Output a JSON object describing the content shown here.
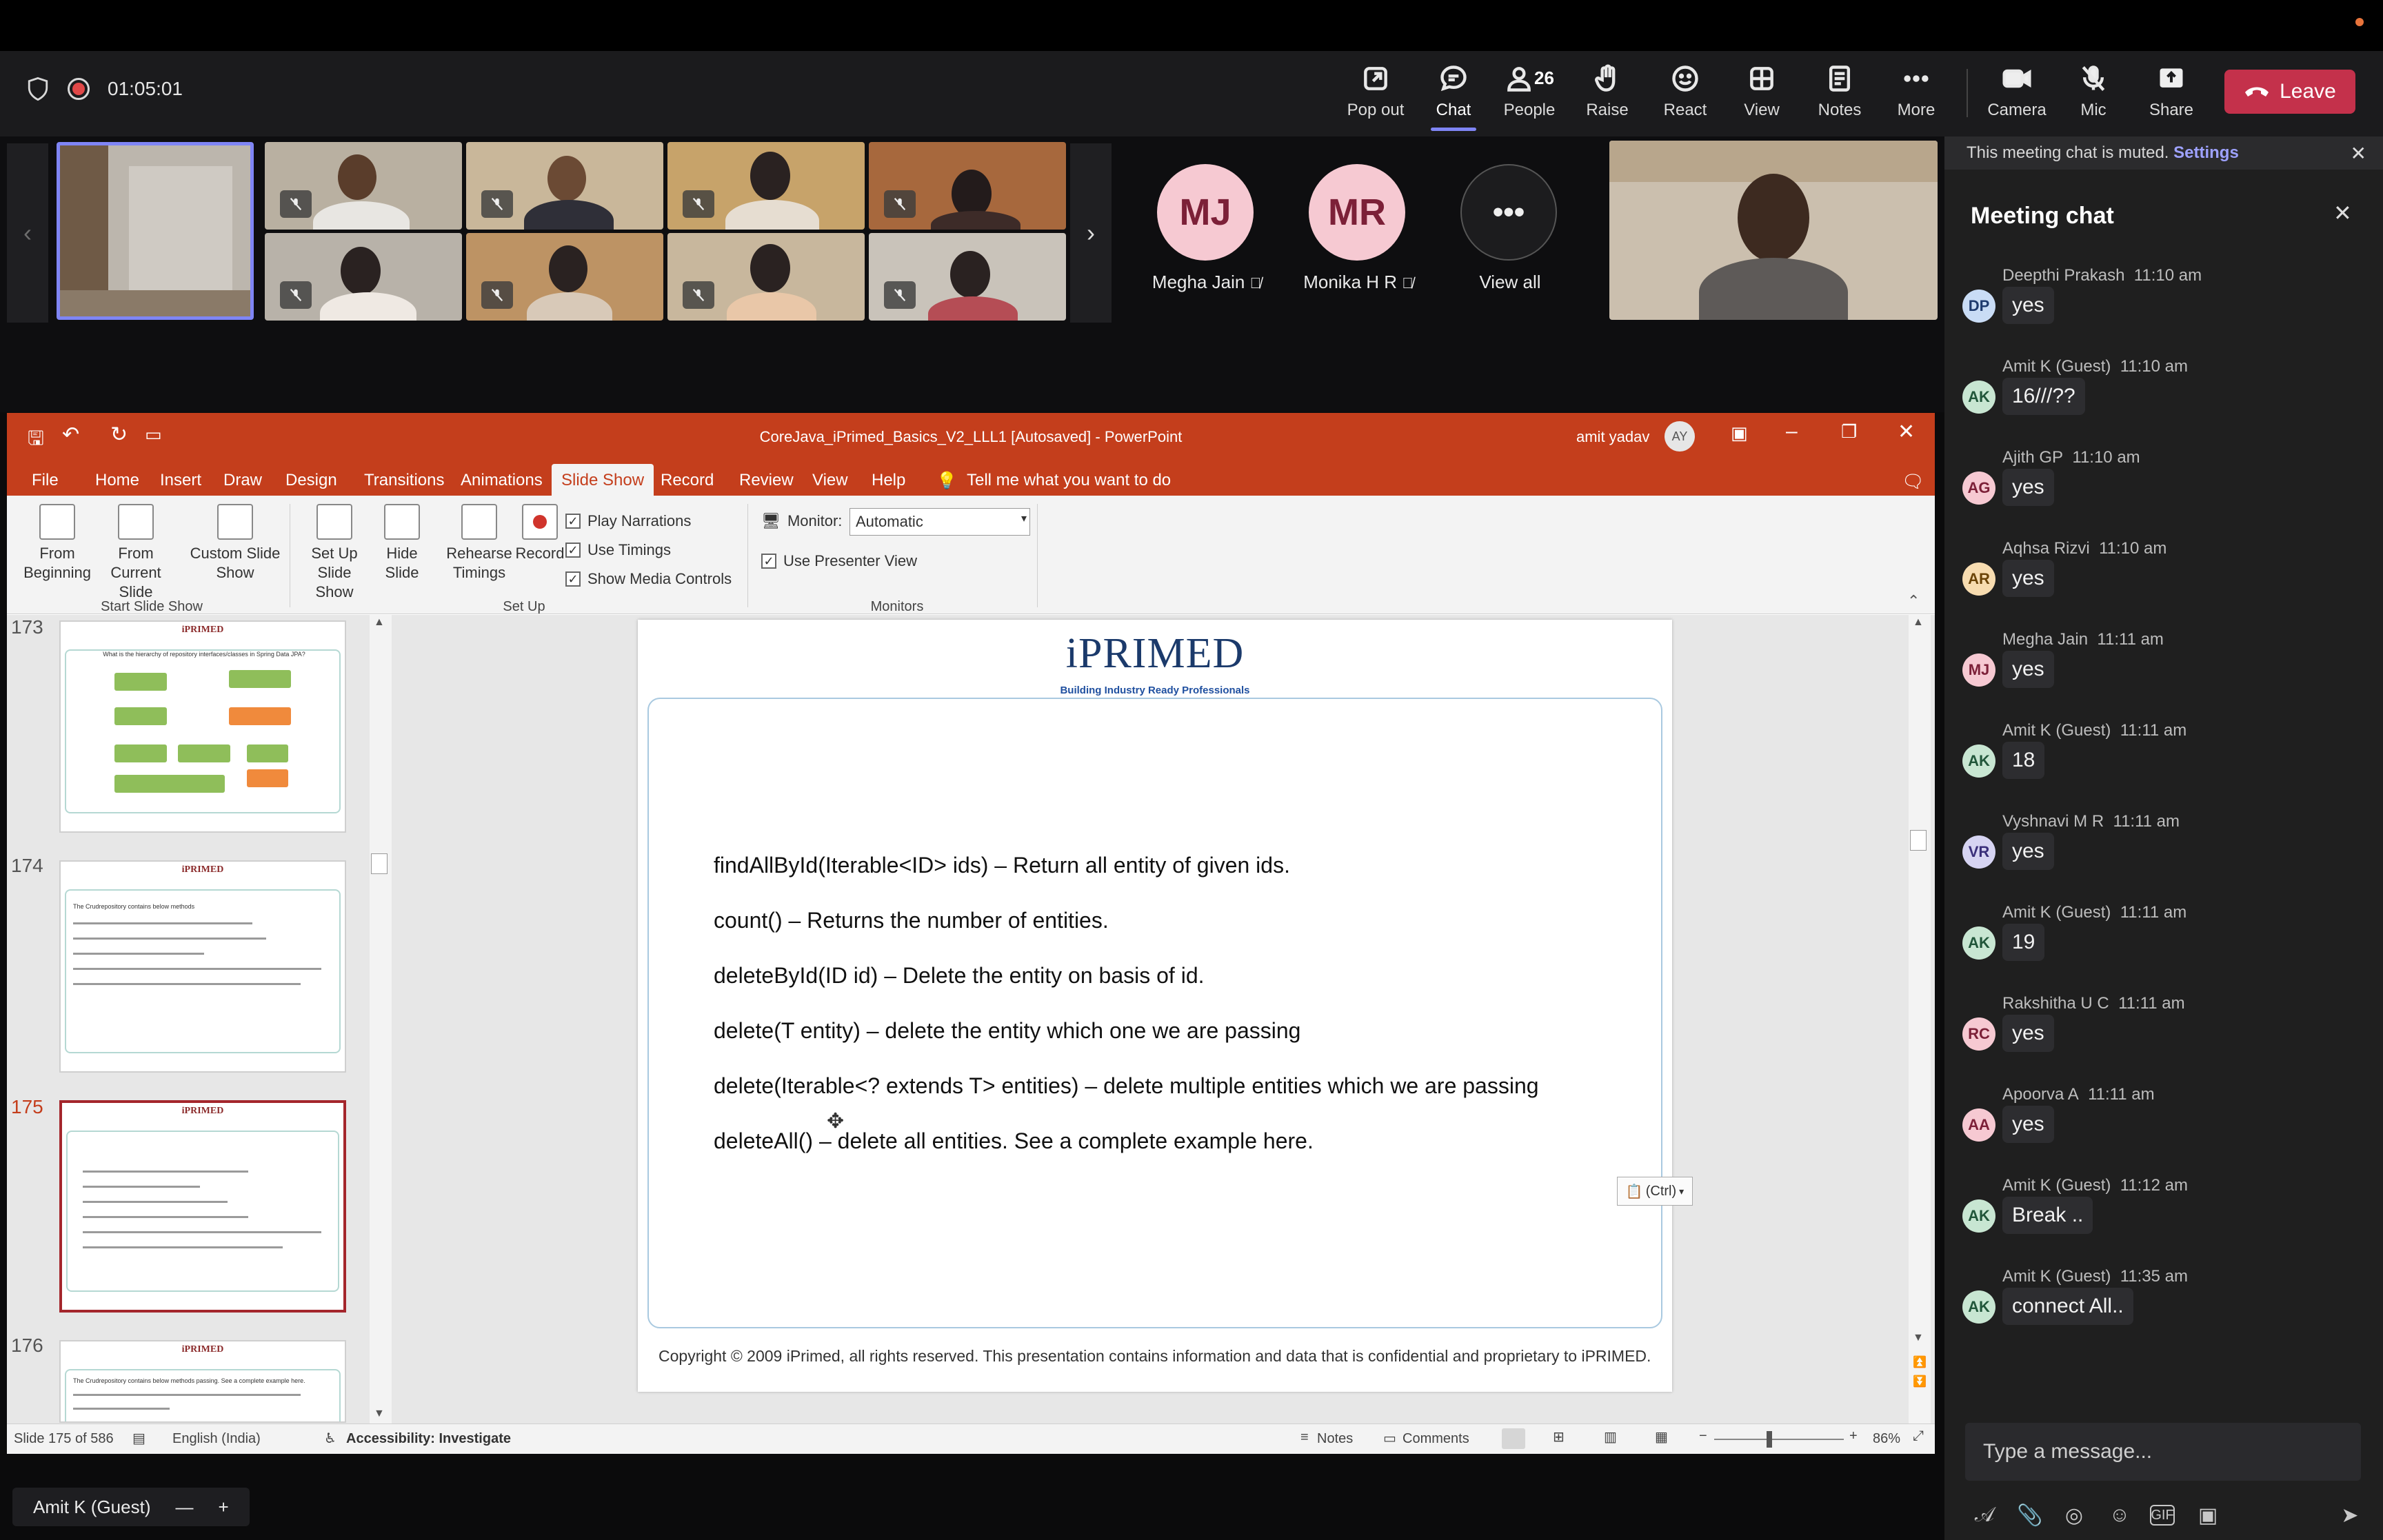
{
  "meeting": {
    "timer": "01:05:01",
    "toolbar": {
      "popout": "Pop out",
      "chat": "Chat",
      "people": "People",
      "people_count": "26",
      "raise": "Raise",
      "react": "React",
      "view": "View",
      "notes": "Notes",
      "more": "More",
      "camera": "Camera",
      "mic": "Mic",
      "share": "Share",
      "leave": "Leave"
    },
    "participants": [
      {
        "initials": "MJ",
        "name": "Megha Jain"
      },
      {
        "initials": "MR",
        "name": "Monika H R"
      }
    ],
    "view_all": "View all",
    "presenter_tag": "Amit K (Guest)",
    "zoom_out": "—",
    "zoom_in": "+"
  },
  "powerpoint": {
    "window_title": "CoreJava_iPrimed_Basics_V2_LLL1 [Autosaved]  -  PowerPoint",
    "user_name": "amit yadav",
    "user_initials": "AY",
    "tabs": [
      "File",
      "Home",
      "Insert",
      "Draw",
      "Design",
      "Transitions",
      "Animations",
      "Slide Show",
      "Record",
      "Review",
      "View",
      "Help"
    ],
    "active_tab": "Slide Show",
    "tell_me": "Tell me what you want to do",
    "ribbon": {
      "from_beginning": "From Beginning",
      "from_current": "From Current Slide",
      "custom_show": "Custom Slide Show",
      "group_start": "Start Slide Show",
      "setup_show": "Set Up Slide Show",
      "hide_slide": "Hide Slide",
      "rehearse": "Rehearse Timings",
      "record": "Record",
      "play_narrations": "Play Narrations",
      "use_timings": "Use Timings",
      "show_media_controls": "Show Media Controls",
      "group_setup": "Set Up",
      "monitor_label": "Monitor:",
      "monitor_value": "Automatic",
      "use_presenter_view": "Use Presenter View",
      "group_monitors": "Monitors"
    },
    "thumbnails": [
      {
        "num": "173",
        "heading": "What is the hierarchy of repository interfaces/classes in Spring Data JPA?"
      },
      {
        "num": "174",
        "heading": "The Crudrepository contains below methods"
      },
      {
        "num": "175",
        "heading": ""
      },
      {
        "num": "176",
        "heading": "The Crudrepository contains below methods passing. See a complete example here."
      }
    ],
    "slide": {
      "logo": "iPRIMED",
      "tagline": "Building Industry Ready Professionals",
      "lines": [
        "findAllById(Iterable<ID> ids)  – Return all entity of given ids.",
        "count() – Returns the number of entities.",
        "deleteById(ID id) – Delete the entity on basis of id.",
        "delete(T entity) – delete the entity which one we are passing",
        "delete(Iterable<? extends T> entities) – delete multiple entities which we are passing",
        "deleteAll() – delete all entities.  See a complete example here."
      ],
      "paste_tag": "(Ctrl)",
      "copyright": "Copyright © 2009 iPrimed, all rights reserved. This presentation contains information  and data  that is confidential and proprietary to iPRIMED."
    },
    "status": {
      "slide_of": "Slide 175 of 586",
      "language": "English (India)",
      "accessibility": "Accessibility: Investigate",
      "notes": "Notes",
      "comments": "Comments",
      "zoom": "86%"
    }
  },
  "chat": {
    "muted_notice": "This meeting chat is muted.",
    "settings_link": "Settings",
    "title": "Meeting chat",
    "input_placeholder": "Type a message...",
    "messages": [
      {
        "sender": "Deepthi Prakash",
        "time": "11:10 am",
        "initials": "DP",
        "text": "yes",
        "color": "#c9dcf5",
        "fg": "#1f3b6e"
      },
      {
        "sender": "Amit K (Guest)",
        "time": "11:10 am",
        "initials": "AK",
        "text": "16///??",
        "color": "#c8e6d2",
        "fg": "#21563a"
      },
      {
        "sender": "Ajith GP",
        "time": "11:10 am",
        "initials": "AG",
        "text": "yes",
        "color": "#f6c9d2",
        "fg": "#7c2038"
      },
      {
        "sender": "Aqhsa Rizvi",
        "time": "11:10 am",
        "initials": "AR",
        "text": "yes",
        "color": "#f7dcb0",
        "fg": "#6b4408"
      },
      {
        "sender": "Megha Jain",
        "time": "11:11 am",
        "initials": "MJ",
        "text": "yes",
        "color": "#f6c9d2",
        "fg": "#7c2038"
      },
      {
        "sender": "Amit K (Guest)",
        "time": "11:11 am",
        "initials": "AK",
        "text": "18",
        "color": "#c8e6d2",
        "fg": "#21563a"
      },
      {
        "sender": "Vyshnavi M R",
        "time": "11:11 am",
        "initials": "VR",
        "text": "yes",
        "color": "#d6d4f2",
        "fg": "#3a2f7a"
      },
      {
        "sender": "Amit K (Guest)",
        "time": "11:11 am",
        "initials": "AK",
        "text": "19",
        "color": "#c8e6d2",
        "fg": "#21563a"
      },
      {
        "sender": "Rakshitha U C",
        "time": "11:11 am",
        "initials": "RC",
        "text": "yes",
        "color": "#f6c9d2",
        "fg": "#7c2038"
      },
      {
        "sender": "Apoorva A",
        "time": "11:11 am",
        "initials": "AA",
        "text": "yes",
        "color": "#f6c9d2",
        "fg": "#7c2038"
      },
      {
        "sender": "Amit K (Guest)",
        "time": "11:12 am",
        "initials": "AK",
        "text": "Break ..",
        "color": "#c8e6d2",
        "fg": "#21563a"
      },
      {
        "sender": "Amit K (Guest)",
        "time": "11:35 am",
        "initials": "AK",
        "text": "connect All..",
        "color": "#c8e6d2",
        "fg": "#21563a"
      }
    ]
  }
}
